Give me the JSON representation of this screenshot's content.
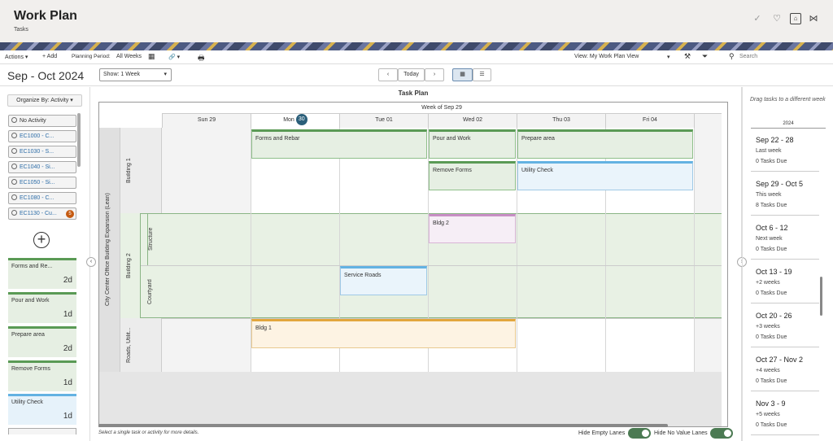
{
  "header": {
    "title": "Work Plan",
    "subtitle": "Tasks",
    "icons": [
      "check-icon",
      "heart-pulse-icon",
      "badge-icon",
      "share-icon"
    ]
  },
  "toolbar": {
    "actions": "Actions ▾",
    "add": "+ Add",
    "planning_period_label": "Planning Period:",
    "planning_period_value": "All Weeks",
    "attach": "🔗 ▾",
    "print": "🖶",
    "view": "View: My Work Plan View",
    "view_caret": "▾",
    "search": "Search"
  },
  "period": {
    "title": "Sep - Oct 2024",
    "show": "Show: 1 Week",
    "prev": "‹",
    "today": "Today",
    "next": "›"
  },
  "left": {
    "organize": "Organize By: Activity ▾",
    "activities": [
      {
        "label": "No Activity"
      },
      {
        "label": "EC1000 - C..."
      },
      {
        "label": "EC1030 - S..."
      },
      {
        "label": "EC1040 - Si..."
      },
      {
        "label": "EC1050 - Si..."
      },
      {
        "label": "EC1080 - C..."
      },
      {
        "label": "EC1130 - Cu...",
        "badge": "5"
      }
    ],
    "cards": [
      {
        "name": "Forms and Re...",
        "dur": "2d"
      },
      {
        "name": "Pour and Work",
        "dur": "1d"
      },
      {
        "name": "Prepare area",
        "dur": "2d"
      },
      {
        "name": "Remove Forms",
        "dur": "1d"
      },
      {
        "name": "Utility Check",
        "dur": "1d"
      }
    ]
  },
  "planner": {
    "title": "Task Plan",
    "week": "Week of Sep 29",
    "days": [
      {
        "label": "Sun 29"
      },
      {
        "label": "Mon",
        "pill": "30"
      },
      {
        "label": "Tue 01"
      },
      {
        "label": "Wed 02"
      },
      {
        "label": "Thu 03"
      },
      {
        "label": "Fri 04"
      }
    ],
    "project": "City Center Office Building Expansion (Lean)",
    "lanes": [
      "Building 1",
      "Building 2",
      "Structure",
      "Courtyard",
      "Roads, Utilit..."
    ],
    "tasks": [
      "Forms and Rebar",
      "Pour and Work",
      "Prepare area",
      "Remove Forms",
      "Utility Check",
      "Bldg 2",
      "Service Roads",
      "Bldg 1"
    ]
  },
  "right": {
    "hint": "Drag tasks to a different week",
    "year": "2024",
    "weeks": [
      {
        "range": "Sep 22 - 28",
        "rel": "Last week",
        "due": "0 Tasks Due"
      },
      {
        "range": "Sep 29 - Oct 5",
        "rel": "This week",
        "due": "8 Tasks Due"
      },
      {
        "range": "Oct 6 - 12",
        "rel": "Next week",
        "due": "0 Tasks Due"
      },
      {
        "range": "Oct 13 - 19",
        "rel": "+2 weeks",
        "due": "0 Tasks Due"
      },
      {
        "range": "Oct 20 - 26",
        "rel": "+3 weeks",
        "due": "0 Tasks Due"
      },
      {
        "range": "Oct 27 - Nov 2",
        "rel": "+4 weeks",
        "due": "0 Tasks Due"
      },
      {
        "range": "Nov 3 - 9",
        "rel": "+5 weeks",
        "due": "0 Tasks Due"
      }
    ]
  },
  "footer": {
    "hint": "Select a single task or activity for more details.",
    "hide_empty": "Hide Empty Lanes",
    "hide_novalue": "Hide No Value Lanes"
  }
}
